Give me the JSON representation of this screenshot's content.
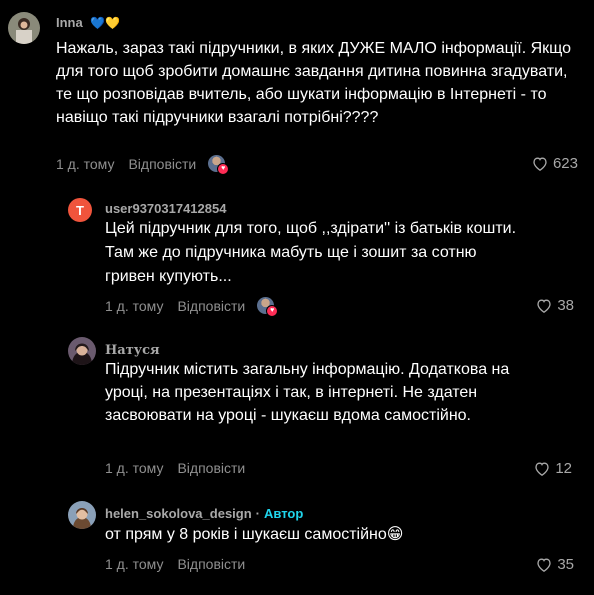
{
  "comments": [
    {
      "username": "Inna",
      "flags": "💙💛",
      "text": "Нажаль, зараз такі підручники, в яких ДУЖЕ МАЛО інформації. Якщо для того щоб зробити домашнє завдання дитина повинна згадувати, те що розповідав вчитель, або шукати інформацію в Інтернеті - то навіщо такі підручники взагалі потрібні????",
      "time": "1 д. тому",
      "reply_label": "Відповісти",
      "likes": "623"
    }
  ],
  "replies": [
    {
      "username": "user9370317412854",
      "avatar_letter": "T",
      "avatar_color": "#f0543c",
      "text": "Цей підручник для того, щоб ,,здірати'' із батьків кошти. Там же до підручника мабуть ще і зошит за сотню гривен купують...",
      "time": "1 д. тому",
      "reply_label": "Відповісти",
      "likes": "38"
    },
    {
      "username": "Натуся",
      "text": "Підручник містить загальну інформацію. Додаткова на уроці, на презентаціях і так, в інтернеті. Не здатен засвоювати на уроці - шукаєш вдома самостійно.",
      "time": "1 д. тому",
      "reply_label": "Відповісти",
      "likes": "12"
    },
    {
      "username": "helen_sokolova_design",
      "author_label": "Автор",
      "text": "от прям у 8 років і шукаєш самостійно😁",
      "time": "1 д. тому",
      "reply_label": "Відповісти",
      "likes": "35"
    }
  ],
  "colors": {
    "background": "#000000",
    "like_heart": "#a8a8a8",
    "author_accent": "#20d5ec",
    "creator_badge": "#fe2c55"
  }
}
